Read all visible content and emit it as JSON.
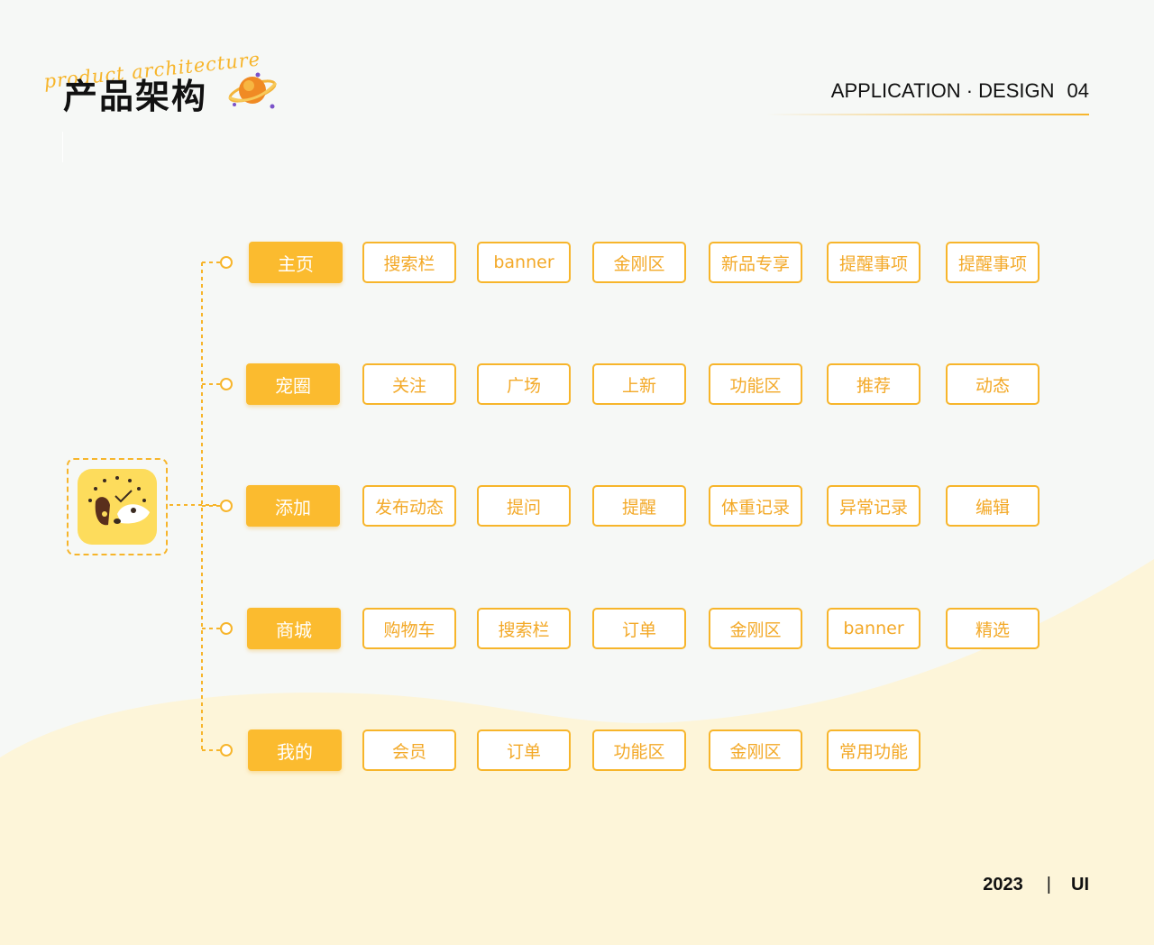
{
  "header": {
    "script_text": "product architecture",
    "title": "产品架构",
    "right_label": "APPLICATION · DESIGN",
    "right_number": "04"
  },
  "colors": {
    "accent": "#fbbb2f",
    "leaf_border": "#f7b52b",
    "leaf_text": "#f3a928",
    "background": "#f6f8f6",
    "wave": "#fdf5d9"
  },
  "icons": {
    "app": "dog-clock-icon",
    "decoration": "planet-icon"
  },
  "tree": [
    {
      "label": "主页",
      "children": [
        "搜索栏",
        "banner",
        "金刚区",
        "新品专享",
        "提醒事项",
        "提醒事项"
      ]
    },
    {
      "label": "宠圈",
      "children": [
        "关注",
        "广场",
        "上新",
        "功能区",
        "推荐",
        "动态"
      ]
    },
    {
      "label": "添加",
      "children": [
        "发布动态",
        "提问",
        "提醒",
        "体重记录",
        "异常记录",
        "编辑"
      ]
    },
    {
      "label": "商城",
      "children": [
        "购物车",
        "搜索栏",
        "订单",
        "金刚区",
        "banner",
        "精选"
      ]
    },
    {
      "label": "我的",
      "children": [
        "会员",
        "订单",
        "功能区",
        "金刚区",
        "常用功能"
      ]
    }
  ],
  "footer": {
    "year": "2023",
    "separator": "|",
    "label": "UI"
  }
}
